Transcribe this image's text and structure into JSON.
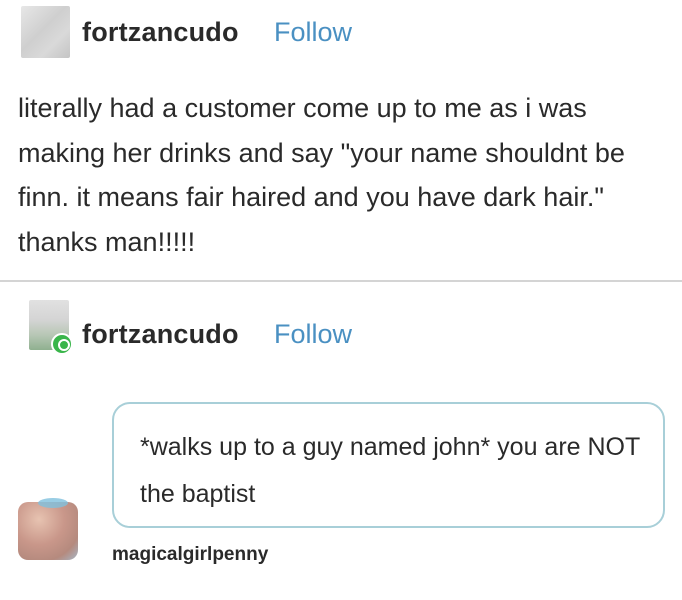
{
  "post1": {
    "username": "fortzancudo",
    "follow_label": "Follow",
    "body": "literally had a customer come up to me as i was making her drinks and say \"your name shouldnt be finn. it means fair haired and you have dark hair.\" thanks man!!!!!"
  },
  "post2": {
    "username": "fortzancudo",
    "follow_label": "Follow",
    "ask": {
      "text": "*walks up to a guy named john* you are NOT the baptist",
      "asker": "magicalgirlpenny"
    }
  },
  "colors": {
    "follow": "#4a90c2",
    "bubble_border": "#a8cfd8",
    "badge": "#39b54a",
    "divider": "#d4d4d4"
  },
  "icons": {
    "post1_avatar": "avatar-image",
    "post2_avatar": "avatar-image",
    "post2_badge": "reblog-badge-icon",
    "asker_avatar": "avatar-image"
  }
}
